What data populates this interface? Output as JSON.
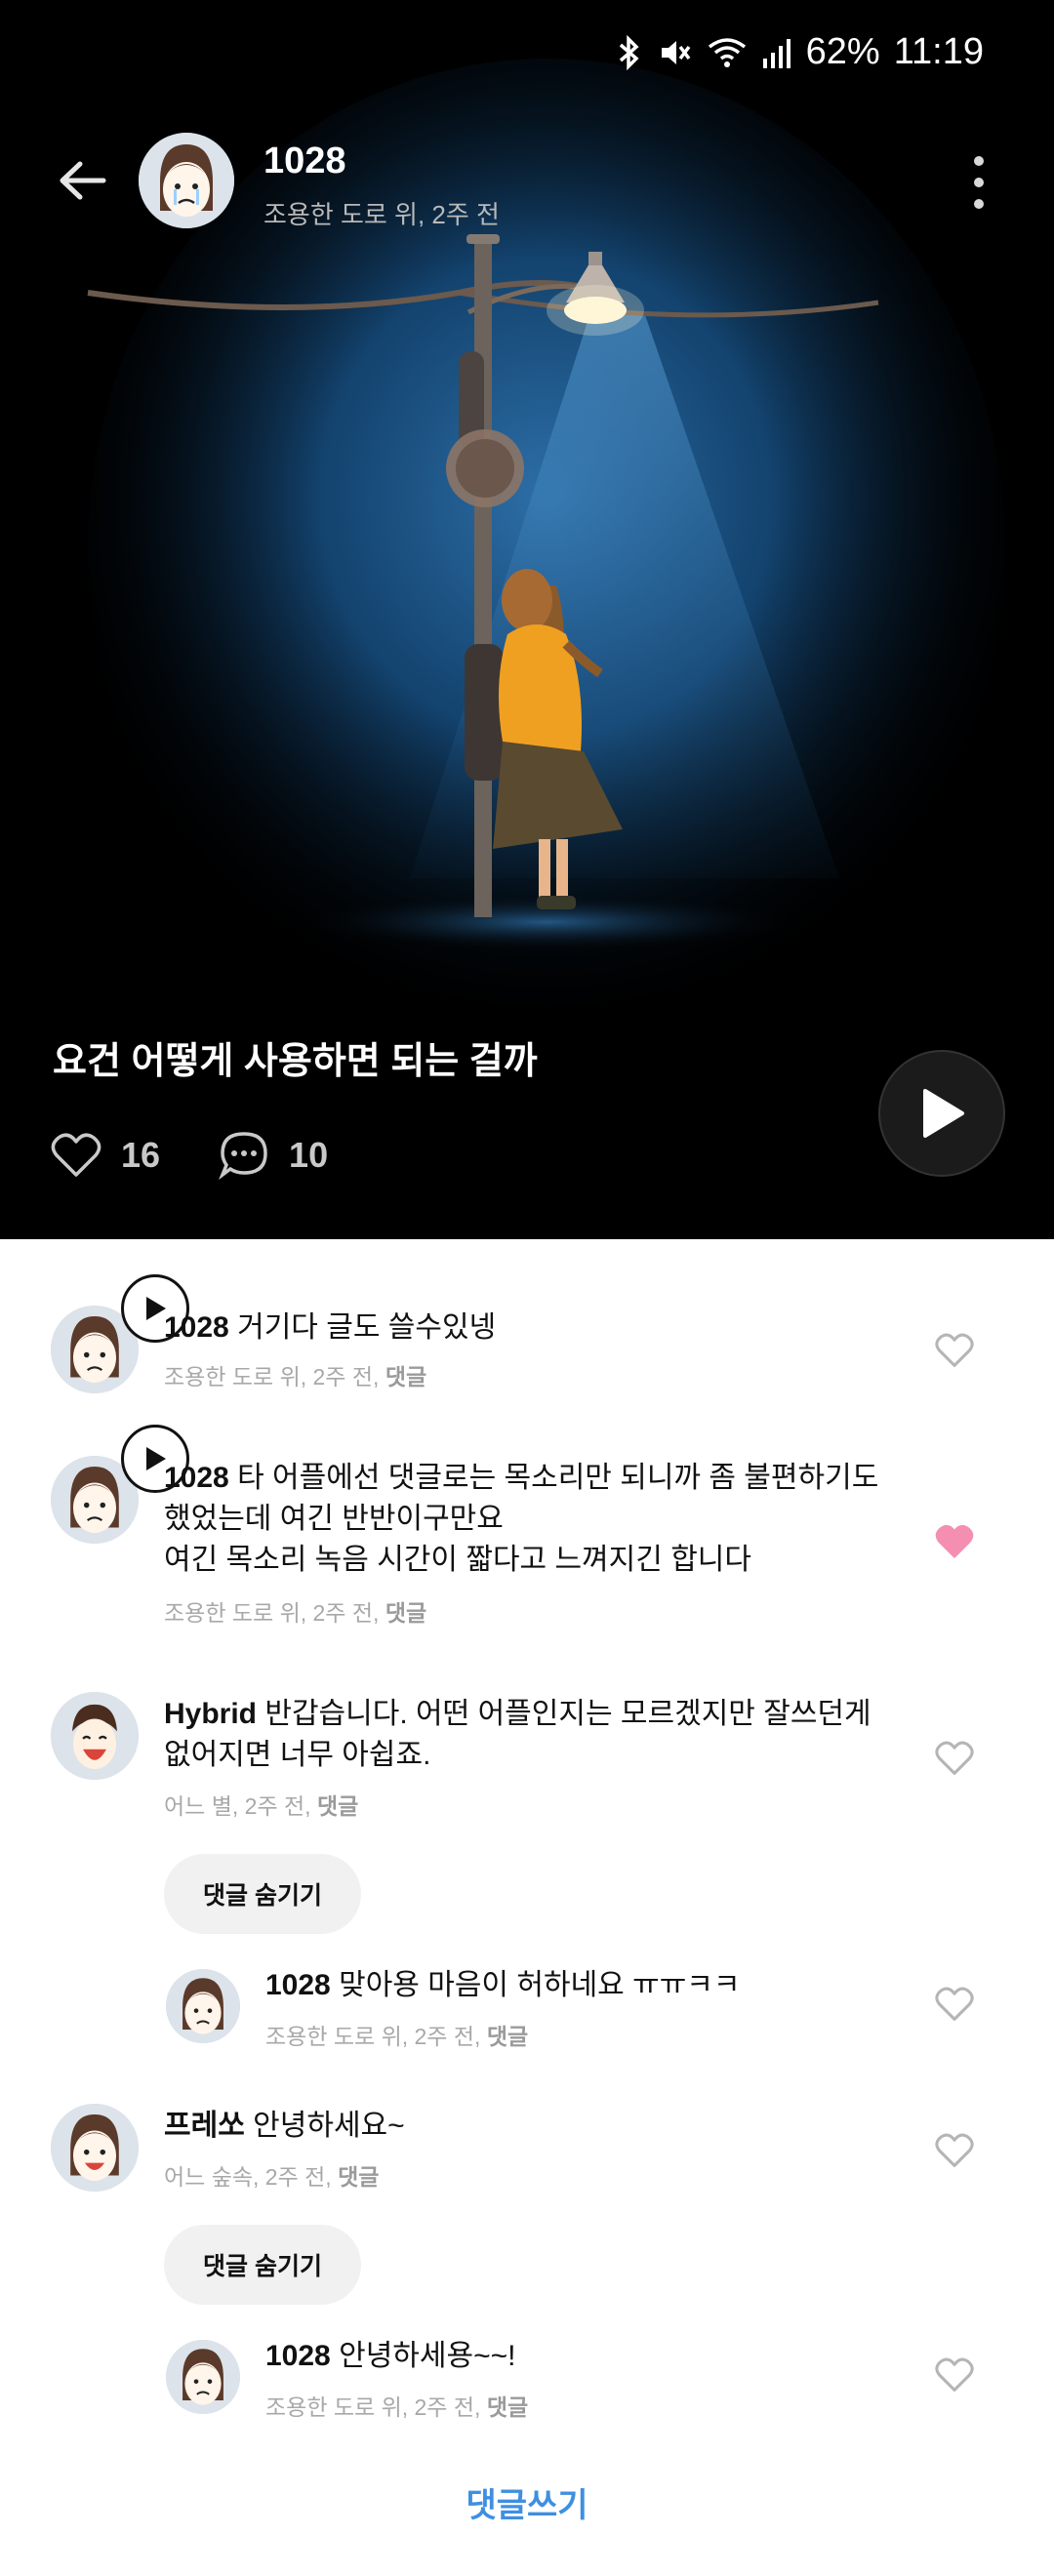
{
  "status_bar": {
    "battery": "62%",
    "time": "11:19"
  },
  "post": {
    "author": "1028",
    "location_time": "조용한 도로 위, 2주 전",
    "title": "요건 어떻게 사용하면 되는 걸까",
    "likes": "16",
    "comments_count": "10"
  },
  "comments": [
    {
      "author": "1028",
      "text": "거기다 글도 쓸수있넹",
      "meta": "조용한 도로 위,  2주 전,",
      "reply_label": "댓글",
      "liked": false,
      "voice": true
    },
    {
      "author": "1028",
      "text_line1": "타 어플에선 댓글로는 목소리만 되니까 좀 불편하기도",
      "text_line2": "했었는데 여긴 반반이구만요",
      "text_line3": "여긴 목소리 녹음 시간이 짧다고 느껴지긴 합니다",
      "meta": "조용한 도로 위,  2주 전,",
      "reply_label": "댓글",
      "liked": true,
      "voice": true
    },
    {
      "author": "Hybrid",
      "text_line1": "반갑습니다. 어떤 어플인지는 모르겠지만 잘쓰던게",
      "text_line2": "없어지면 너무 아쉽죠.",
      "meta": "어느 별,  2주 전,",
      "reply_label": "댓글",
      "liked": false,
      "hide_label": "댓글 숨기기",
      "reply": {
        "author": "1028",
        "text": "맞아용 마음이 허하네요 ㅠㅠㅋㅋ",
        "meta": "조용한 도로 위,  2주 전,",
        "reply_label": "댓글"
      }
    },
    {
      "author": "프레쏘",
      "text": "안녕하세요~",
      "meta": "어느 숲속,  2주 전,",
      "reply_label": "댓글",
      "liked": false,
      "hide_label": "댓글 숨기기",
      "reply": {
        "author": "1028",
        "text": "안녕하세용~~!",
        "meta": "조용한 도로 위,  2주 전,",
        "reply_label": "댓글"
      }
    }
  ],
  "write_comment": "댓글쓰기",
  "colors": {
    "accent": "#3f8fe0",
    "liked_heart": "#f48fb1",
    "hero_bg": "#000000"
  },
  "icons": [
    "bluetooth-icon",
    "mute-icon",
    "wifi-icon",
    "signal-icon",
    "back-arrow-icon",
    "more-vert-icon",
    "heart-icon",
    "comment-icon",
    "play-icon"
  ]
}
